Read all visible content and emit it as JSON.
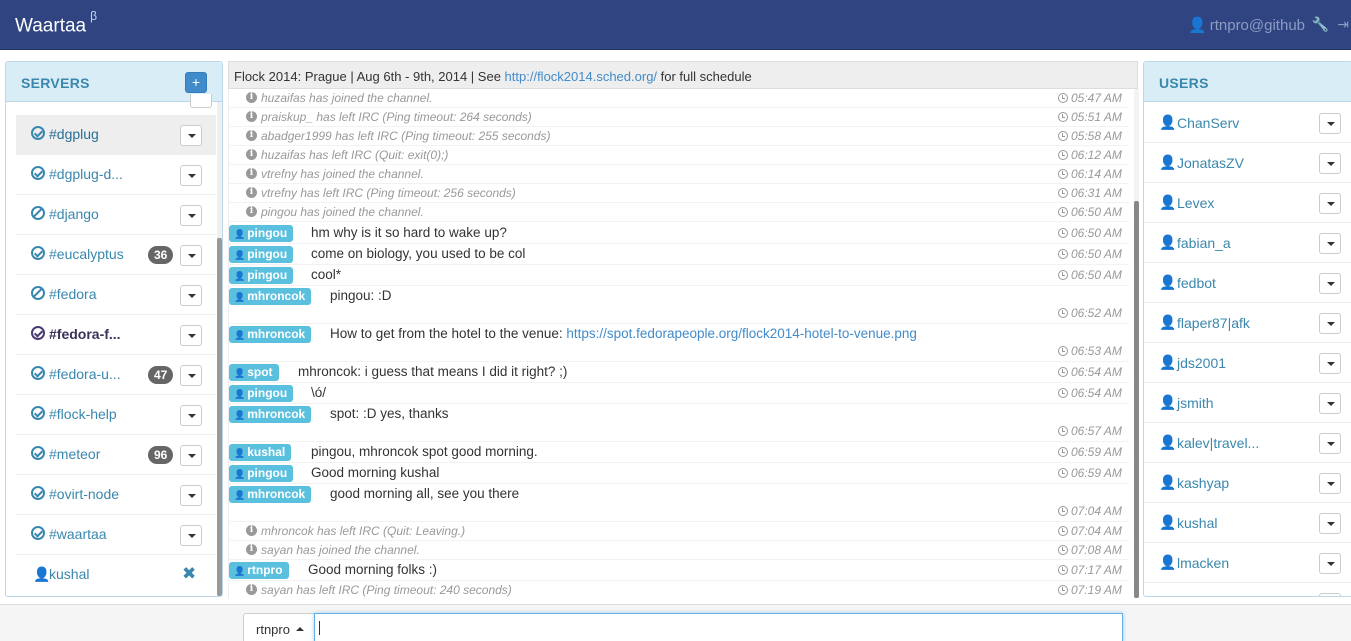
{
  "app": {
    "title": "Waartaa",
    "badge": "β",
    "user": "rtnpro@github"
  },
  "servers": {
    "title": "SERVERS",
    "add_label": "+",
    "channels": [
      {
        "name": "#dgplug",
        "icon": "check-circle-icon",
        "active": true
      },
      {
        "name": "#dgplug-d...",
        "icon": "check-circle-icon"
      },
      {
        "name": "#django",
        "icon": "ban-circle-icon"
      },
      {
        "name": "#eucalyptus",
        "icon": "check-circle-icon",
        "badge": "36"
      },
      {
        "name": "#fedora",
        "icon": "ban-circle-icon"
      },
      {
        "name": "#fedora-f...",
        "icon": "check-circle-icon",
        "bold": true
      },
      {
        "name": "#fedora-u...",
        "icon": "check-circle-icon",
        "badge": "47"
      },
      {
        "name": "#flock-help",
        "icon": "check-circle-icon"
      },
      {
        "name": "#meteor",
        "icon": "check-circle-icon",
        "badge": "96"
      },
      {
        "name": "#ovirt-node",
        "icon": "check-circle-icon"
      },
      {
        "name": "#waartaa",
        "icon": "check-circle-icon"
      }
    ],
    "query": {
      "name": "kushal",
      "close": "✖"
    }
  },
  "topic": {
    "prefix": "Flock 2014: Prague | Aug 6th - 9th, 2014 | See ",
    "link": "http://flock2014.sched.org/",
    "suffix": " for full schedule"
  },
  "events": [
    {
      "text": "huzaifas has joined the channel.",
      "time": "05:47 AM"
    },
    {
      "text": "praiskup_ has left IRC (Ping timeout: 264 seconds)",
      "time": "05:51 AM"
    },
    {
      "text": "abadger1999 has left IRC (Ping timeout: 255 seconds)",
      "time": "05:58 AM"
    },
    {
      "text": "huzaifas has left IRC (Quit: exit(0);)",
      "time": "06:12 AM"
    },
    {
      "text": "vtrefny has joined the channel.",
      "time": "06:14 AM"
    },
    {
      "text": "vtrefny has left IRC (Ping timeout: 256 seconds)",
      "time": "06:31 AM"
    },
    {
      "text": "pingou has joined the channel.",
      "time": "06:50 AM"
    }
  ],
  "messages": [
    {
      "nick": "pingou",
      "text": "hm why is it so hard to wake up?",
      "time": "06:50 AM"
    },
    {
      "nick": "pingou",
      "text": "come on biology, you used to be col",
      "time": "06:50 AM"
    },
    {
      "nick": "pingou",
      "text": "cool*",
      "time": "06:50 AM"
    },
    {
      "nick": "mhroncok",
      "text": "pingou: :D",
      "time": "06:52 AM"
    },
    {
      "nick": "mhroncok",
      "text": "How to get from the hotel to the venue: ",
      "link": "https://spot.fedorapeople.org/flock2014-hotel-to-venue.png",
      "time": "06:53 AM"
    },
    {
      "nick": "spot",
      "text": "mhroncok: i guess that means I did it right? ;)",
      "time": "06:54 AM"
    },
    {
      "nick": "pingou",
      "text": "\\ó/",
      "time": "06:54 AM"
    },
    {
      "nick": "mhroncok",
      "text": "spot: :D yes, thanks",
      "time": "06:57 AM"
    },
    {
      "nick": "kushal",
      "text": "pingou, mhroncok spot good morning.",
      "time": "06:59 AM"
    },
    {
      "nick": "pingou",
      "text": "Good morning kushal",
      "time": "06:59 AM"
    },
    {
      "nick": "mhroncok",
      "text": "good morning all, see you there",
      "time": "07:04 AM"
    }
  ],
  "events2": [
    {
      "text": "mhroncok has left IRC (Quit: Leaving.)",
      "time": "07:04 AM"
    },
    {
      "text": "sayan has joined the channel.",
      "time": "07:08 AM"
    }
  ],
  "messages2": [
    {
      "nick": "rtnpro",
      "text": "Good morning folks :)",
      "time": "07:17 AM"
    }
  ],
  "events3": [
    {
      "text": "sayan has left IRC (Ping timeout: 240 seconds)",
      "time": "07:19 AM"
    }
  ],
  "users": {
    "title": "USERS",
    "list": [
      "ChanServ",
      "JonatasZV",
      "Levex",
      "fabian_a",
      "fedbot",
      "flaper87|afk",
      "jds2001",
      "jsmith",
      "kalev|travel...",
      "kashyap",
      "kushal",
      "lmacken"
    ]
  },
  "input": {
    "nick": "rtnpro",
    "value": ""
  }
}
